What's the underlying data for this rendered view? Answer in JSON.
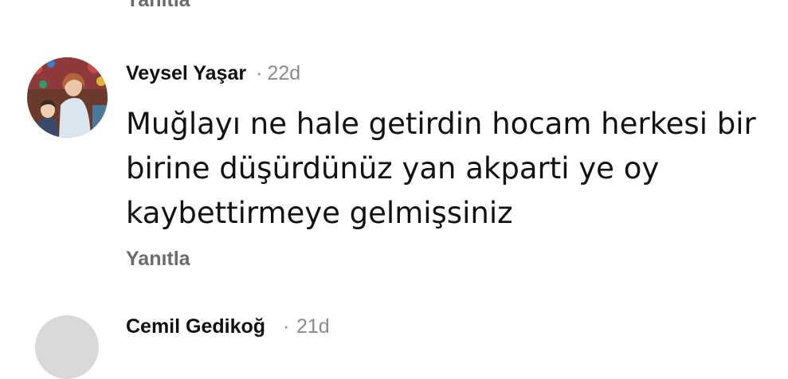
{
  "previous_comment": {
    "reply_label": "Yanıtla"
  },
  "comment": {
    "author": "Veysel Yaşar",
    "separator": "·",
    "time": "22d",
    "text": "Muğlayı ne hale getirdin hocam herkesi bir birine düşürdünüz yan akparti ye oy kaybettirmeye gelmişsiniz",
    "reply_label": "Yanıtla",
    "avatar_icon": "profile-photo"
  },
  "next_comment": {
    "author": "Cemil Gedikoğ",
    "separator": "·",
    "time": "21d"
  }
}
